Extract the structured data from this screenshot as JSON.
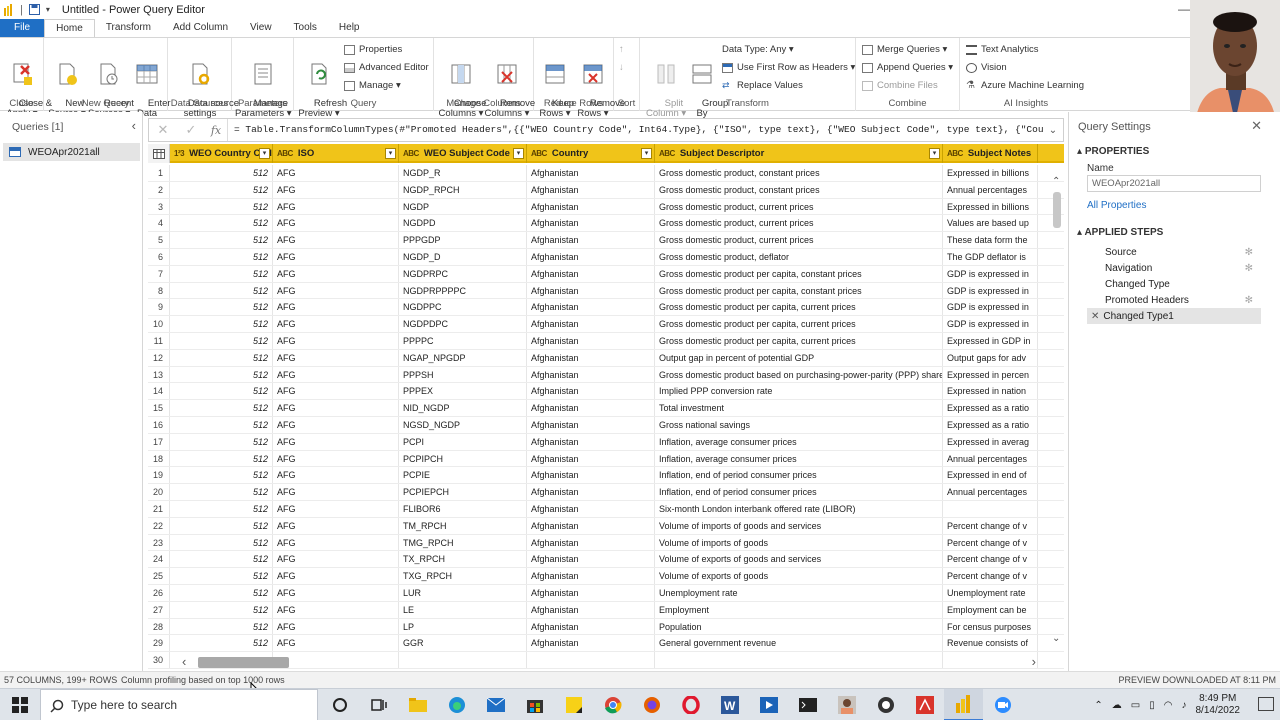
{
  "window": {
    "title": "Untitled - Power Query Editor"
  },
  "ribbon_tabs": [
    "File",
    "Home",
    "Transform",
    "Add Column",
    "View",
    "Tools",
    "Help"
  ],
  "ribbon": {
    "close_group": {
      "label": "Close",
      "close_apply": "Close &\nApply ▾"
    },
    "new_query_group": {
      "label": "New Query",
      "new_source": "New\nSource ▾",
      "recent_sources": "Recent\nSources ▾",
      "enter_data": "Enter\nData"
    },
    "data_sources_group": {
      "label": "Data Sources",
      "settings": "Data source\nsettings"
    },
    "parameters_group": {
      "label": "Parameters",
      "manage": "Manage\nParameters ▾"
    },
    "query_group": {
      "label": "Query",
      "refresh": "Refresh\nPreview ▾",
      "properties": "Properties",
      "advanced_editor": "Advanced Editor",
      "manage": "Manage ▾"
    },
    "manage_columns_group": {
      "label": "Manage Columns",
      "choose": "Choose\nColumns ▾",
      "remove": "Remove\nColumns ▾"
    },
    "reduce_rows_group": {
      "label": "Reduce Rows",
      "keep": "Keep\nRows ▾",
      "remove": "Remove\nRows ▾"
    },
    "sort_group": {
      "label": "Sort"
    },
    "transform_group": {
      "label": "Transform",
      "split": "Split\nColumn ▾",
      "group_by": "Group\nBy",
      "data_type": "Data Type: Any ▾",
      "first_row": "Use First Row as Headers ▾",
      "replace": "Replace Values"
    },
    "combine_group": {
      "label": "Combine",
      "merge": "Merge Queries ▾",
      "append": "Append Queries ▾",
      "combine_files": "Combine Files"
    },
    "ai_group": {
      "label": "AI Insights",
      "text": "Text Analytics",
      "vision": "Vision",
      "ml": "Azure Machine Learning"
    }
  },
  "queries_pane": {
    "header": "Queries [1]",
    "items": [
      "WEOApr2021all"
    ]
  },
  "formula": "= Table.TransformColumnTypes(#\"Promoted Headers\",{{\"WEO Country Code\", Int64.Type}, {\"ISO\", type text}, {\"WEO Subject Code\", type text}, {\"Country\",",
  "grid": {
    "columns": [
      {
        "type": "1²3",
        "name": "WEO Country Code"
      },
      {
        "type": "ABC",
        "name": "ISO"
      },
      {
        "type": "ABC",
        "name": "WEO Subject Code"
      },
      {
        "type": "ABC",
        "name": "Country"
      },
      {
        "type": "ABC",
        "name": "Subject Descriptor"
      },
      {
        "type": "ABC",
        "name": "Subject Notes"
      }
    ],
    "rows": [
      [
        "1",
        "512",
        "AFG",
        "NGDP_R",
        "Afghanistan",
        "Gross domestic product, constant prices",
        "Expressed in billions"
      ],
      [
        "2",
        "512",
        "AFG",
        "NGDP_RPCH",
        "Afghanistan",
        "Gross domestic product, constant prices",
        "Annual percentages"
      ],
      [
        "3",
        "512",
        "AFG",
        "NGDP",
        "Afghanistan",
        "Gross domestic product, current prices",
        "Expressed in billions"
      ],
      [
        "4",
        "512",
        "AFG",
        "NGDPD",
        "Afghanistan",
        "Gross domestic product, current prices",
        "Values are based up"
      ],
      [
        "5",
        "512",
        "AFG",
        "PPPGDP",
        "Afghanistan",
        "Gross domestic product, current prices",
        "These data form the"
      ],
      [
        "6",
        "512",
        "AFG",
        "NGDP_D",
        "Afghanistan",
        "Gross domestic product, deflator",
        "The GDP deflator is"
      ],
      [
        "7",
        "512",
        "AFG",
        "NGDPRPC",
        "Afghanistan",
        "Gross domestic product per capita, constant prices",
        "GDP is expressed in"
      ],
      [
        "8",
        "512",
        "AFG",
        "NGDPRPPPPC",
        "Afghanistan",
        "Gross domestic product per capita, constant prices",
        "GDP is expressed in"
      ],
      [
        "9",
        "512",
        "AFG",
        "NGDPPC",
        "Afghanistan",
        "Gross domestic product per capita, current prices",
        "GDP is expressed in"
      ],
      [
        "10",
        "512",
        "AFG",
        "NGDPDPC",
        "Afghanistan",
        "Gross domestic product per capita, current prices",
        "GDP is expressed in"
      ],
      [
        "11",
        "512",
        "AFG",
        "PPPPC",
        "Afghanistan",
        "Gross domestic product per capita, current prices",
        "Expressed in GDP in"
      ],
      [
        "12",
        "512",
        "AFG",
        "NGAP_NPGDP",
        "Afghanistan",
        "Output gap in percent of potential GDP",
        "Output gaps for adv"
      ],
      [
        "13",
        "512",
        "AFG",
        "PPPSH",
        "Afghanistan",
        "Gross domestic product based on purchasing-power-parity (PPP) share...",
        "Expressed in percen"
      ],
      [
        "14",
        "512",
        "AFG",
        "PPPEX",
        "Afghanistan",
        "Implied PPP conversion rate",
        "Expressed in nation"
      ],
      [
        "15",
        "512",
        "AFG",
        "NID_NGDP",
        "Afghanistan",
        "Total investment",
        "Expressed as a ratio"
      ],
      [
        "16",
        "512",
        "AFG",
        "NGSD_NGDP",
        "Afghanistan",
        "Gross national savings",
        "Expressed as a ratio"
      ],
      [
        "17",
        "512",
        "AFG",
        "PCPI",
        "Afghanistan",
        "Inflation, average consumer prices",
        "Expressed in averag"
      ],
      [
        "18",
        "512",
        "AFG",
        "PCPIPCH",
        "Afghanistan",
        "Inflation, average consumer prices",
        "Annual percentages"
      ],
      [
        "19",
        "512",
        "AFG",
        "PCPIE",
        "Afghanistan",
        "Inflation, end of period consumer prices",
        "Expressed in end of"
      ],
      [
        "20",
        "512",
        "AFG",
        "PCPIEPCH",
        "Afghanistan",
        "Inflation, end of period consumer prices",
        "Annual percentages"
      ],
      [
        "21",
        "512",
        "AFG",
        "FLIBOR6",
        "Afghanistan",
        "Six-month London interbank offered rate (LIBOR)",
        ""
      ],
      [
        "22",
        "512",
        "AFG",
        "TM_RPCH",
        "Afghanistan",
        "Volume of imports of goods and services",
        "Percent change of v"
      ],
      [
        "23",
        "512",
        "AFG",
        "TMG_RPCH",
        "Afghanistan",
        "Volume of imports of goods",
        "Percent change of v"
      ],
      [
        "24",
        "512",
        "AFG",
        "TX_RPCH",
        "Afghanistan",
        "Volume of exports of goods and services",
        "Percent change of v"
      ],
      [
        "25",
        "512",
        "AFG",
        "TXG_RPCH",
        "Afghanistan",
        "Volume of exports of goods",
        "Percent change of v"
      ],
      [
        "26",
        "512",
        "AFG",
        "LUR",
        "Afghanistan",
        "Unemployment rate",
        "Unemployment rate"
      ],
      [
        "27",
        "512",
        "AFG",
        "LE",
        "Afghanistan",
        "Employment",
        "Employment can be"
      ],
      [
        "28",
        "512",
        "AFG",
        "LP",
        "Afghanistan",
        "Population",
        "For census purposes"
      ],
      [
        "29",
        "512",
        "AFG",
        "GGR",
        "Afghanistan",
        "General government revenue",
        "Revenue consists of"
      ],
      [
        "30",
        "",
        "",
        "",
        "",
        "",
        ""
      ]
    ]
  },
  "settings": {
    "title": "Query Settings",
    "properties": "PROPERTIES",
    "name_label": "Name",
    "name_value": "WEOApr2021all",
    "all_properties": "All Properties",
    "applied_steps": "APPLIED STEPS",
    "steps": [
      "Source",
      "Navigation",
      "Changed Type",
      "Promoted Headers",
      "Changed Type1"
    ]
  },
  "status": {
    "left": "57 COLUMNS, 199+ ROWS",
    "profiling": "Column profiling based on top 1000 rows",
    "right": "PREVIEW DOWNLOADED AT 8:11 PM"
  },
  "taskbar": {
    "search_placeholder": "Type here to search",
    "time": "8:49 PM",
    "date": "8/14/2022"
  },
  "colors": {
    "header_yellow": "#f0c419",
    "accent_blue": "#1f6fc5"
  }
}
